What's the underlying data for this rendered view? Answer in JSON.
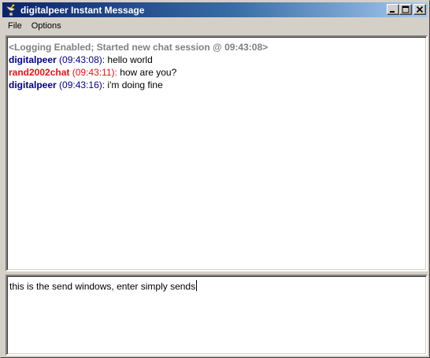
{
  "window": {
    "title": "digitalpeer Instant Message"
  },
  "menu": {
    "items": [
      "File",
      "Options"
    ]
  },
  "colors": {
    "title_start": "#0a246a",
    "title_end": "#a6caf0",
    "self_nick": "#00008b",
    "other_nick": "#ee1111",
    "system": "#808080"
  },
  "chat_log": {
    "system_line": "<Logging Enabled; Started new chat session @ 09:43:08>",
    "messages": [
      {
        "nick": "digitalpeer",
        "time": "(09:43:08):",
        "text": " hello world",
        "kind": "self"
      },
      {
        "nick": "rand2002chat",
        "time": "(09:43:11):",
        "text": " how are you?",
        "kind": "other"
      },
      {
        "nick": "digitalpeer",
        "time": "(09:43:16):",
        "text": " i'm doing fine",
        "kind": "self"
      }
    ]
  },
  "send_box": {
    "value": "this is the send windows, enter simply sends"
  },
  "icons": {
    "app": "satellite-dish-icon",
    "minimize": "minimize-icon",
    "maximize": "maximize-icon",
    "close": "close-icon"
  }
}
